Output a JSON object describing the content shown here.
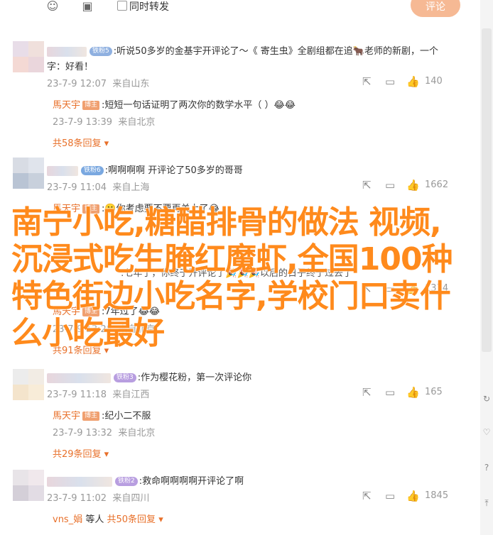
{
  "toolbar": {
    "forward_label": "同时转发",
    "submit_label": "评论"
  },
  "comments": [
    {
      "badge": "铁粉5",
      "text": ":听说50多岁的金基宇开评论了～《 寄生虫》全剧组都在追🐂老师的新剧，一个",
      "text2": "字：好看！",
      "date": "23-7-9 12:07",
      "location": "来自山东",
      "likes": "140",
      "reply": {
        "name": "馬天宇",
        "badge": "博主",
        "text": ":短短一句话证明了两次你的数学水平（     ）",
        "emoji": "😂😂",
        "date": "23-7-9 13:39",
        "location": "来自北京"
      },
      "more": "共58条回复"
    },
    {
      "badge": "铁粉6",
      "text": ":啊啊啊啊 开评论了50多岁的哥哥",
      "date": "23-7-9 11:04",
      "location": "来自上海",
      "likes": "1662",
      "reply": {
        "name": "馬天宇",
        "badge": "博主",
        "text": ":🤫你考虑要不要再关上了",
        "emoji": "😂",
        "date": "",
        "location": ""
      },
      "more": ""
    },
    {
      "badge": "",
      "text": ":七年了，你终于开评论了🎉🎉🎉以后的日子终于过去了",
      "date": "",
      "location": "",
      "likes": "1374",
      "reply": {
        "name": "馬天宇",
        "badge": "博主",
        "text": ":7年过了",
        "emoji": "😂😂",
        "date": "23-7-9 13:28",
        "location": "来自北京"
      },
      "more": "共91条回复"
    },
    {
      "badge": "铁粉3",
      "text": ":作为樱花粉，第一次评论你",
      "date": "23-7-9 11:18",
      "location": "来自江西",
      "likes": "165",
      "reply": {
        "name": "馬天宇",
        "badge": "博主",
        "text": ":纪小二不服",
        "emoji": "",
        "date": "23-7-9 13:32",
        "location": "来自北京"
      },
      "more": "共29条回复"
    },
    {
      "badge": "铁粉2",
      "text": ":救命啊啊啊啊开评论了啊",
      "date": "23-7-9 11:02",
      "location": "来自四川",
      "likes": "1845",
      "reply": {
        "name": "vns_娟",
        "badge": "",
        "text": "等人",
        "emoji": "",
        "date": "",
        "location": ""
      },
      "more": "共50条回复"
    }
  ],
  "overlay": {
    "title": "南宁小吃,糖醋排骨的做法 视频,沉浸式吃生腌红魔虾,全国100种特色街边小吃名字,学校门口卖什么小吃最好"
  },
  "colors": {
    "accent": "#e8702a",
    "overlay": "#ff8a1c",
    "submit": "#f6b994"
  }
}
